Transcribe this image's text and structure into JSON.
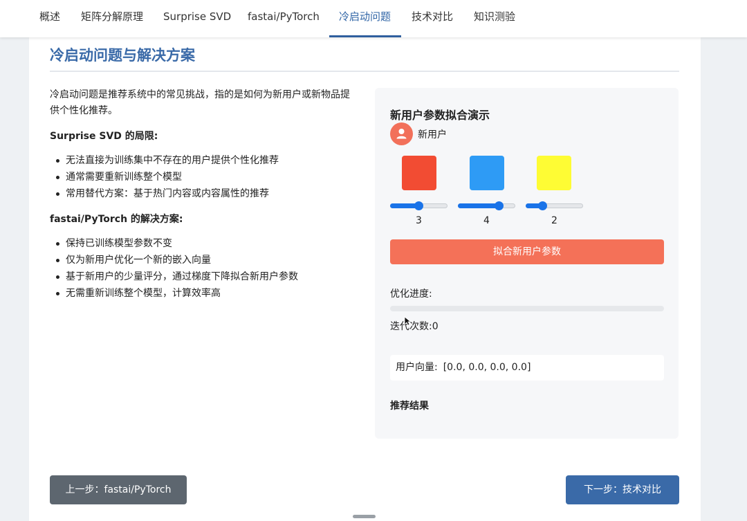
{
  "nav": {
    "tabs": [
      {
        "label": "概述"
      },
      {
        "label": "矩阵分解原理"
      },
      {
        "label": "Surprise SVD"
      },
      {
        "label": "fastai/PyTorch"
      },
      {
        "label": "冷启动问题"
      },
      {
        "label": "技术对比"
      },
      {
        "label": "知识测验"
      }
    ],
    "active_index": 4
  },
  "page": {
    "title": "冷启动问题与解决方案",
    "intro": "冷启动问题是推荐系统中的常见挑战，指的是如何为新用户或新物品提供个性化推荐。",
    "surprise": {
      "heading": "Surprise SVD 的局限:",
      "items": [
        "无法直接为训练集中不存在的用户提供个性化推荐",
        "通常需要重新训练整个模型",
        "常用替代方案：基于热门内容或内容属性的推荐"
      ]
    },
    "fastai": {
      "heading": "fastai/PyTorch 的解决方案:",
      "items": [
        "保持已训练模型参数不变",
        "仅为新用户优化一个新的嵌入向量",
        "基于新用户的少量评分，通过梯度下降拟合新用户参数",
        "无需重新训练整个模型，计算效率高"
      ]
    }
  },
  "demo": {
    "title": "新用户参数拟合演示",
    "user_label": "新用户",
    "user_icon": "person-icon",
    "sliders": [
      {
        "color": "#f24c33",
        "value": "3",
        "level": 0.5
      },
      {
        "color": "#2e9bf5",
        "value": "4",
        "level": 0.75
      },
      {
        "color": "#fefc34",
        "value": "2",
        "level": 0.25
      }
    ],
    "fit_button": "拟合新用户参数",
    "progress_label": "优化进度:",
    "progress": 0,
    "iter_label": "迭代次数:",
    "iter_value": "0",
    "vector_label": "用户向量:",
    "vector_value": "[0.0, 0.0, 0.0, 0.0]",
    "results_title": "推荐结果"
  },
  "footer": {
    "prev_label": "上一步：fastai/PyTorch",
    "next_label": "下一步：技术对比"
  },
  "colors": {
    "accent": "#3a6aa8",
    "fit_button": "#f47158",
    "prev_button": "#5d666f",
    "slider": "#1a73e8"
  }
}
